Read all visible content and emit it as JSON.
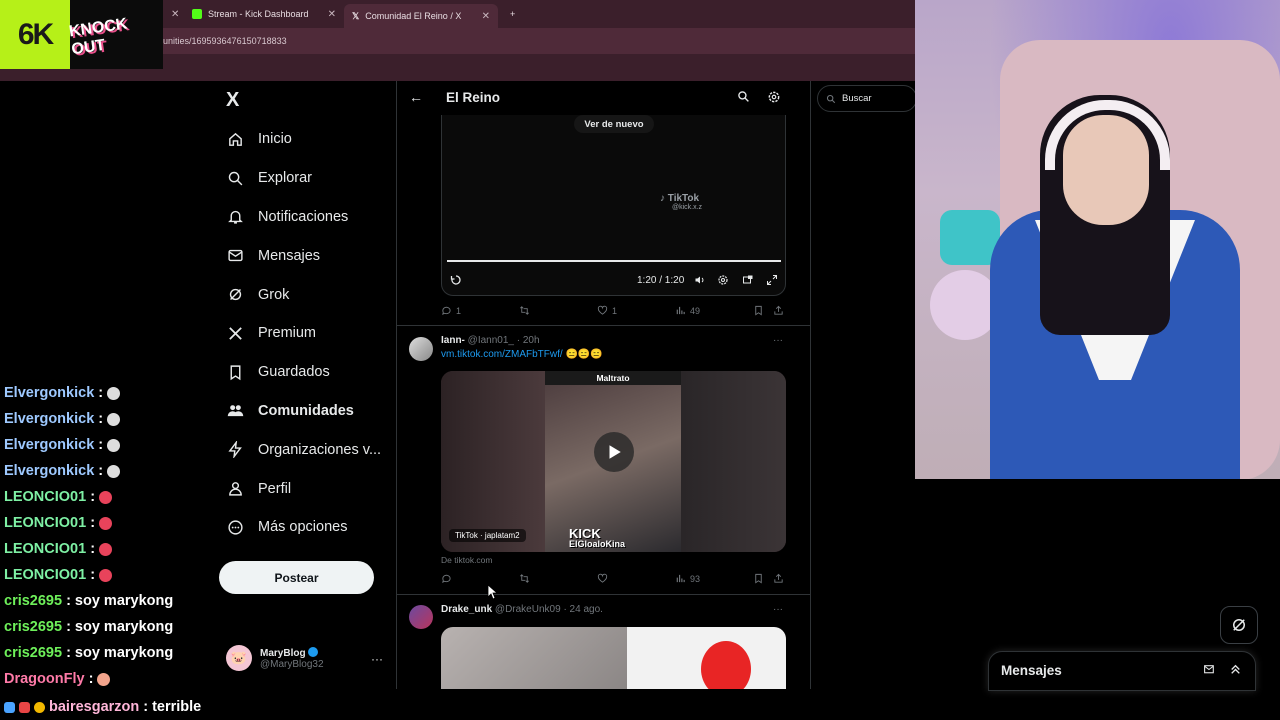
{
  "browser": {
    "tabs": [
      {
        "label": "Stream - Kick Dashboard",
        "favicon_color": "#53fc18"
      },
      {
        "label": "Comunidad El Reino / X",
        "favicon_color": "#ffffff"
      }
    ],
    "url": "unities/1695936476150718833",
    "new_tab_icon": "+"
  },
  "overlay": {
    "logo_text": "6K",
    "knockout_text": "KNOCK OUT"
  },
  "chat": {
    "lines": [
      {
        "user": "Elvergonkick",
        "sep": ":",
        "color": "#9ec9ff",
        "msg": "",
        "emote": "#dddddd"
      },
      {
        "user": "Elvergonkick",
        "sep": ":",
        "color": "#9ec9ff",
        "msg": "",
        "emote": "#dddddd"
      },
      {
        "user": "Elvergonkick",
        "sep": ":",
        "color": "#9ec9ff",
        "msg": "",
        "emote": "#dddddd"
      },
      {
        "user": "Elvergonkick",
        "sep": ":",
        "color": "#9ec9ff",
        "msg": "",
        "emote": "#dddddd"
      },
      {
        "user": "LEONCIO01",
        "sep": ":",
        "color": "#7ef0a4",
        "msg": "",
        "emote": "#e8435b"
      },
      {
        "user": "LEONCIO01",
        "sep": ":",
        "color": "#7ef0a4",
        "msg": "",
        "emote": "#e8435b"
      },
      {
        "user": "LEONCIO01",
        "sep": ":",
        "color": "#7ef0a4",
        "msg": "",
        "emote": "#e8435b"
      },
      {
        "user": "LEONCIO01",
        "sep": ":",
        "color": "#7ef0a4",
        "msg": "",
        "emote": "#e8435b"
      },
      {
        "user": "cris2695",
        "sep": ":",
        "color": "#6ef05a",
        "msg": "soy marykong",
        "emote": ""
      },
      {
        "user": "cris2695",
        "sep": ":",
        "color": "#6ef05a",
        "msg": "soy marykong",
        "emote": ""
      },
      {
        "user": "cris2695",
        "sep": ":",
        "color": "#6ef05a",
        "msg": "soy marykong",
        "emote": ""
      },
      {
        "user": "DragoonFly",
        "sep": ":",
        "color": "#ff7aa8",
        "msg": "",
        "emote": "#f2a48c"
      }
    ],
    "bottom": {
      "user": "bairesgarzon",
      "sep": ":",
      "color": "#ffb6d9",
      "msg": "terrible"
    }
  },
  "nav": {
    "logo": "X",
    "items": [
      {
        "label": "Inicio",
        "icon": "home-icon",
        "bold": false
      },
      {
        "label": "Explorar",
        "icon": "search-icon",
        "bold": false
      },
      {
        "label": "Notificaciones",
        "icon": "bell-icon",
        "bold": false
      },
      {
        "label": "Mensajes",
        "icon": "envelope-icon",
        "bold": false
      },
      {
        "label": "Grok",
        "icon": "grok-icon",
        "bold": false
      },
      {
        "label": "Premium",
        "icon": "x-icon",
        "bold": false
      },
      {
        "label": "Guardados",
        "icon": "bookmark-icon",
        "bold": false
      },
      {
        "label": "Comunidades",
        "icon": "people-icon",
        "bold": true
      },
      {
        "label": "Organizaciones v...",
        "icon": "lightning-icon",
        "bold": false
      },
      {
        "label": "Perfil",
        "icon": "person-icon",
        "bold": false
      },
      {
        "label": "Más opciones",
        "icon": "more-circle-icon",
        "bold": false
      }
    ],
    "post_button": "Postear",
    "profile": {
      "name": "MaryBlog",
      "handle": "@MaryBlog32",
      "more": "···"
    }
  },
  "main": {
    "title": "El Reino",
    "tweet1": {
      "replay_label": "Ver de nuevo",
      "watermark": "TikTok",
      "watermark_handle": "@kick.x.z",
      "time": "1:20 / 1:20",
      "replies": "1",
      "likes": "1",
      "views": "49"
    },
    "tweet2": {
      "name": "Iann-",
      "handle": "@Iann01_",
      "time": "· 20h",
      "link": "vm.tiktok.com/ZMAFbTFwf/",
      "emojis": "😑😑😑",
      "video_title": "Maltrato",
      "kick_text": "KICK",
      "kick_sub": "ElGloaloKina",
      "tiktok_label": "TikTok · japlatam2",
      "from_site": "De tiktok.com",
      "views": "93"
    },
    "tweet3": {
      "name": "Drake_unk",
      "handle": "@DrakeUnk09",
      "time": "· 24 ago."
    },
    "more": "···"
  },
  "right": {
    "search_placeholder": "Buscar"
  },
  "messages_dock": {
    "title": "Mensajes"
  }
}
